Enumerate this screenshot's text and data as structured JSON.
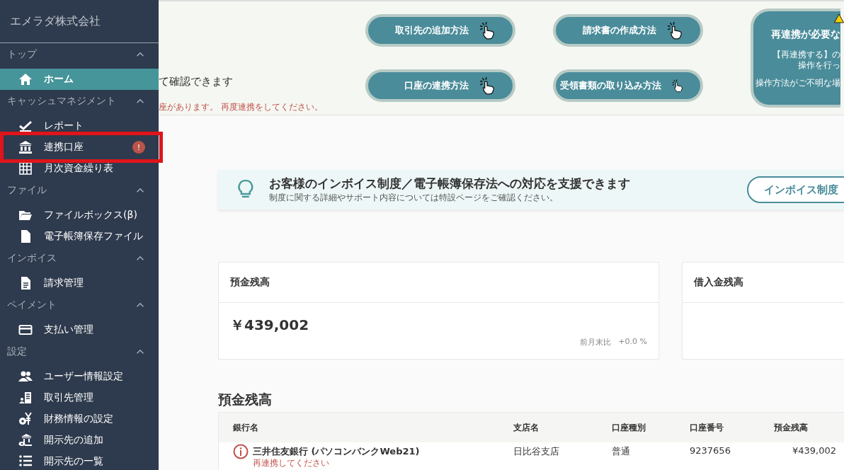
{
  "sidebar": {
    "company": "エメラダ株式会社",
    "sections": [
      {
        "title": "トップ",
        "expanded": true,
        "items": [
          {
            "label": "ホーム",
            "selected": true,
            "highlighted": false
          }
        ]
      },
      {
        "title": "キャッシュマネジメント",
        "expanded": true,
        "items": [
          {
            "label": "レポート",
            "selected": false,
            "highlighted": false
          },
          {
            "label": "連携口座",
            "selected": false,
            "badge": "!",
            "highlighted": true
          },
          {
            "label": "月次資金繰り表",
            "selected": false,
            "highlighted": false
          }
        ]
      },
      {
        "title": "ファイル",
        "expanded": true,
        "items": [
          {
            "label": "ファイルボックス(β)",
            "selected": false,
            "highlighted": false
          },
          {
            "label": "電子帳簿保存ファイル",
            "selected": false,
            "highlighted": false
          }
        ]
      },
      {
        "title": "インボイス",
        "expanded": true,
        "items": [
          {
            "label": "請求管理",
            "selected": false,
            "highlighted": false
          }
        ]
      },
      {
        "title": "ペイメント",
        "expanded": true,
        "items": [
          {
            "label": "支払い管理",
            "selected": false,
            "highlighted": false
          }
        ]
      },
      {
        "title": "設定",
        "expanded": true,
        "items": [
          {
            "label": "ユーザー情報設定",
            "selected": false,
            "highlighted": false
          },
          {
            "label": "取引先管理",
            "selected": false,
            "highlighted": false
          },
          {
            "label": "財務情報の設定",
            "selected": false,
            "highlighted": false
          },
          {
            "label": "開示先の追加",
            "selected": false,
            "highlighted": false
          },
          {
            "label": "開示先の一覧",
            "selected": false,
            "highlighted": false
          }
        ]
      }
    ]
  },
  "banner": {
    "text": "て確認できます",
    "warning": "座があります。 再度連携をしてください。",
    "help_buttons": [
      {
        "label": "取引先の追加方法"
      },
      {
        "label": "請求書の作成方法"
      },
      {
        "label": "口座の連携方法"
      },
      {
        "label": "受領書類の取り込み方法"
      }
    ],
    "notice_card": {
      "title": "再連携が必要な",
      "lines": [
        "【再連携する】の",
        "操作を行っ",
        "操作方法がご不明な場"
      ]
    }
  },
  "info": {
    "title": "お客様のインボイス制度／電子帳簿保存法への対応を支援できます",
    "subtitle": "制度に関する詳細やサポート内容については特設ページをご確認ください。",
    "button": "インボイス制度"
  },
  "summary_cards": [
    {
      "title": "預金残高",
      "value": "￥439,002",
      "compare_label": "前月末比",
      "compare_value": "+0.0 %"
    },
    {
      "title": "借入金残高"
    }
  ],
  "table": {
    "title": "預金残高",
    "columns": [
      "銀行名",
      "支店名",
      "口座種別",
      "口座番号",
      "預金残高"
    ],
    "rows": [
      {
        "alert": true,
        "note": "再連携してください",
        "cells": [
          "三井住友銀行 (パソコンバンクWeb21)",
          "日比谷支店",
          "普通",
          "9237656",
          "¥439,002"
        ]
      }
    ]
  }
}
